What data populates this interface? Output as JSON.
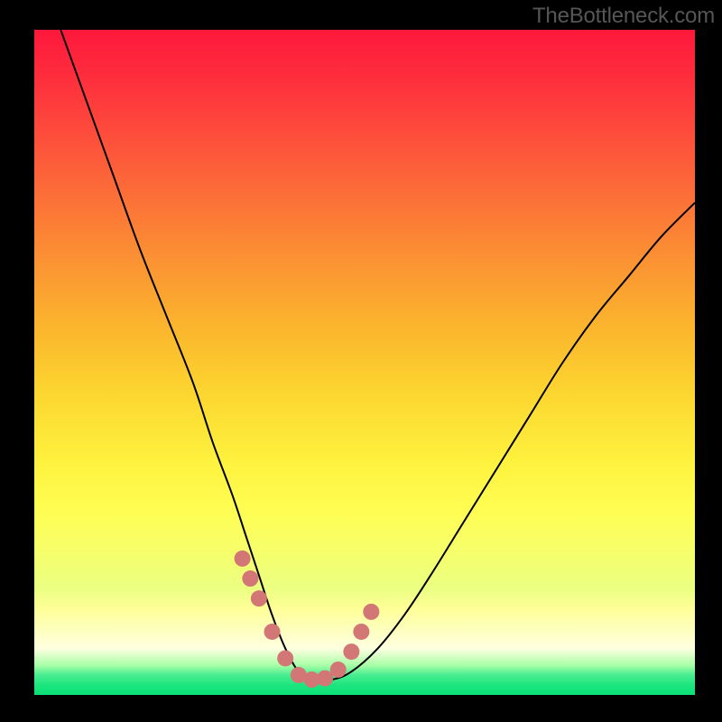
{
  "watermark": "TheBottleneck.com",
  "colors": {
    "bg": "#000000",
    "curve": "#000000",
    "dot_fill": "#d37676",
    "watermark_text": "#565656"
  },
  "gradient_stops": [
    {
      "offset": 0.0,
      "color": "#fe183b"
    },
    {
      "offset": 0.06,
      "color": "#fe2a3d"
    },
    {
      "offset": 0.15,
      "color": "#fd4a3c"
    },
    {
      "offset": 0.25,
      "color": "#fc6f38"
    },
    {
      "offset": 0.35,
      "color": "#fb9333"
    },
    {
      "offset": 0.45,
      "color": "#fbb62d"
    },
    {
      "offset": 0.55,
      "color": "#fcd730"
    },
    {
      "offset": 0.65,
      "color": "#fef23e"
    },
    {
      "offset": 0.72,
      "color": "#fffd52"
    },
    {
      "offset": 0.78,
      "color": "#f7ff69"
    },
    {
      "offset": 0.84,
      "color": "#ebff82"
    },
    {
      "offset": 0.87,
      "color": "#ffff97"
    },
    {
      "offset": 0.9,
      "color": "#fdffbb"
    },
    {
      "offset": 0.93,
      "color": "#ffffe0"
    },
    {
      "offset": 0.955,
      "color": "#aaffa8"
    },
    {
      "offset": 0.97,
      "color": "#4aed91"
    },
    {
      "offset": 0.985,
      "color": "#1de57e"
    },
    {
      "offset": 1.0,
      "color": "#0ae176"
    }
  ],
  "chart_data": {
    "type": "line",
    "title": "",
    "xlabel": "",
    "ylabel": "",
    "xlim": [
      0,
      100
    ],
    "ylim": [
      0,
      100
    ],
    "series": [
      {
        "name": "bottleneck-curve",
        "x": [
          0,
          4,
          8,
          12,
          16,
          20,
          24,
          27,
          30,
          32,
          34,
          36,
          38,
          40,
          42,
          45,
          48,
          52,
          56,
          60,
          65,
          70,
          75,
          80,
          85,
          90,
          95,
          100
        ],
        "y": [
          111,
          100,
          89,
          78,
          67,
          57,
          47,
          38,
          30,
          24,
          18,
          12,
          7,
          3.5,
          2.3,
          2.3,
          3.5,
          7,
          12,
          18,
          26,
          34,
          42,
          50,
          57,
          63,
          69,
          74
        ]
      }
    ],
    "highlight_points": {
      "name": "threshold-markers",
      "x": [
        31.5,
        32.7,
        34.0,
        36.0,
        38.0,
        40.0,
        42.0,
        44.0,
        46.0,
        48.0,
        49.5,
        51.0
      ],
      "y": [
        20.5,
        17.5,
        14.5,
        9.5,
        5.5,
        3.0,
        2.3,
        2.5,
        3.8,
        6.5,
        9.5,
        12.5
      ]
    }
  }
}
